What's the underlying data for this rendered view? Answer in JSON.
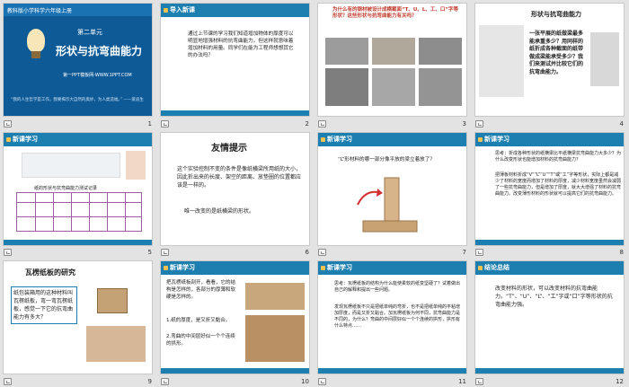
{
  "slides": [
    {
      "num": "1",
      "topbar": "教科版小学科学六年级上册",
      "unit": "第二单元",
      "title": "形状与抗弯曲能力",
      "url": "第一PPT模板网-WWW.1PPT.COM",
      "quote": "“我的人生哲学是工作，我要揭示大自然的奥妙，为人类造福。” ——爱迪生"
    },
    {
      "num": "2",
      "tag": "导入新课",
      "body": "通过上节课的学习我们知道增加物体的厚度可以明显地增强材料的抗弯曲能力。但这样就意味着增加材料的用量。同学们在能为工程师想想其它的办法吗？"
    },
    {
      "num": "3",
      "title": "为什么有的钢材被设计成横截面“T、U、L、工、口”字等形状？这些形状与抗弯曲能力有关吗？"
    },
    {
      "num": "4",
      "heading": "形状与抗弯曲能力",
      "body": "一张平展的纸做梁最多能承重多少？用同样的纸折成各种截面的纸带做成梁能承受多少？我们来测试并比较它们的抗弯曲能力。"
    },
    {
      "num": "5",
      "tag": "新课学习",
      "table_title": "纸的形状与抗弯曲能力测试记录"
    },
    {
      "num": "6",
      "title": "友情提示",
      "body": "这个实验控制不变的条件是像纸横梁所用纸的大小，因此折出来的长度、架空的距离、放垫圈的位置都应该是一样的。",
      "body2": "唯一改变的是纸横梁的形状。"
    },
    {
      "num": "7",
      "tag": "新课学习",
      "question": "“L”形材料的哪一部分像平放的梁立着放了？"
    },
    {
      "num": "8",
      "tag": "新课学习",
      "body": "思考：折成各种形状的纸横梁比平纸横梁抗弯曲能力大多少？为什么改变形状也能增加材料的抗弯曲能力？",
      "body2": "把薄板材料折成“V”“L”“U”“T”或“工”字等形状，实际上都是减少了材料的宽度而增加了材料的厚度，减少材料宽度虽然会减弱了一些抗弯曲能力，但是增加了厚度，就大大增强了材料的抗弯曲能力。改变薄形材料的形状就可以提高它们的抗弯曲能力。"
    },
    {
      "num": "9",
      "title": "瓦楞纸板的研究",
      "body": "纸包装箱用的这种材料叫瓦楞纸板，弯一弯瓦楞纸板，感觉一下它的抗弯曲能力有多大？"
    },
    {
      "num": "10",
      "tag": "新课学习",
      "body": "把瓦楞纸板剖开，看看，它的结构是怎样的，各部分的厚薄和软硬是怎样的。",
      "body2": "1.纸的厚度，是又折又黏合。",
      "body3": "2.弯曲的中间层好似一个个连续的拱形。"
    },
    {
      "num": "11",
      "tag": "新课学习",
      "body": "思考：瓦楞纸板的结构为什么能使柔软的纸变坚硬了？试着做出自己的解释和提出一些问题。",
      "body2": "发现瓦楞纸板不只是把纸单纯的弯折，也不是把纸单纯的平粘增加厚度，而是又折又黏合。加瓦楞纸板为何不同，抗弯曲能力是不同的，为什么？弯曲的中间层好似一个个连续的拱形，拱形有什么特点……"
    },
    {
      "num": "12",
      "tag": "结论总结",
      "body": "改变材料的形状，可以改变材料的抗弯曲能力。“T”、“U”、“L”、“工”字或“口”字等形状的抗弯曲能力强。"
    }
  ]
}
